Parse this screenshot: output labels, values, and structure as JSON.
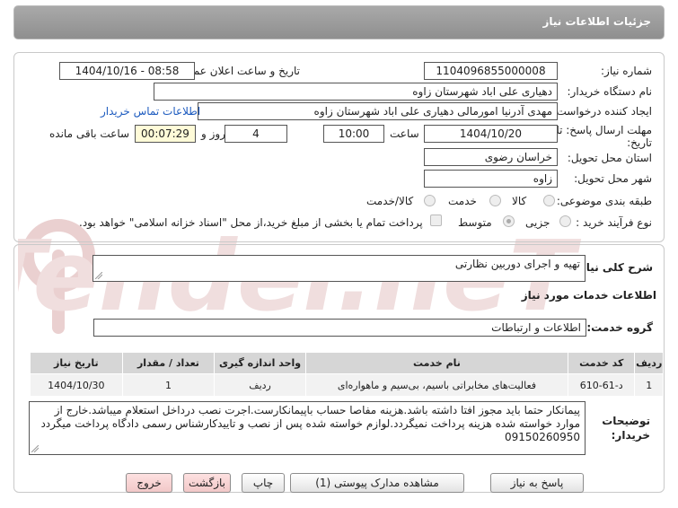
{
  "header": {
    "title": "جزئیات اطلاعات نیاز"
  },
  "watermark": {
    "text": "AriaTender.neT"
  },
  "form": {
    "need_number_label": "شماره نیاز:",
    "need_number": "1104096855000008",
    "announce_label": "تاریخ و ساعت اعلان عمومی:",
    "announce_value": "1404/10/16 - 08:58",
    "buyer_org_label": "نام دستگاه خریدار:",
    "buyer_org": "دهیاری علی اباد شهرستان زاوه",
    "creator_label": "ایجاد کننده درخواست:",
    "creator": "مهدی آدرنیا امورمالی دهیاری علی اباد شهرستان زاوه",
    "contact_link": "اطلاعات تماس خریدار",
    "deadline_label_1": "مهلت ارسال پاسخ: تا",
    "deadline_label_2": "تاریخ:",
    "deadline_date": "1404/10/20",
    "time_label": "ساعت",
    "deadline_time": "10:00",
    "days_value": "4",
    "days_label": "روز و",
    "remaining_time": "00:07:29",
    "remaining_label": "ساعت باقی مانده",
    "province_label": "استان محل تحویل:",
    "province": "خراسان رضوی",
    "city_label": "شهر محل تحویل:",
    "city": "زاوه",
    "category_label": "طبقه بندی موضوعی:",
    "category_options": [
      "کالا",
      "خدمت",
      "کالا/خدمت"
    ],
    "category_selected": "خدمت",
    "process_label": "نوع فرآیند خرید :",
    "process_options": [
      "جزیی",
      "متوسط"
    ],
    "process_selected": "متوسط",
    "payment_note": "پرداخت تمام یا بخشی از مبلغ خرید،از محل \"اسناد خزانه اسلامی\" خواهد بود."
  },
  "need": {
    "summary_label": "شرح کلی نیاز:",
    "summary": "تهیه و اجرای دوربین نظارتی",
    "services_title": "اطلاعات خدمات مورد نیاز",
    "service_group_label": "گروه خدمت:",
    "service_group": "اطلاعات و ارتباطات"
  },
  "table": {
    "headers": [
      "ردیف",
      "کد خدمت",
      "نام خدمت",
      "واحد اندازه گیری",
      "تعداد / مقدار",
      "تاریخ نیاز"
    ],
    "rows": [
      [
        "1",
        "د-61-610",
        "فعالیت‌های مخابراتی باسیم، بی‌سیم و ماهواره‌ای",
        "ردیف",
        "1",
        "1404/10/30"
      ]
    ]
  },
  "buyer_notes": {
    "label_1": "توضیحات",
    "label_2": "خریدار:",
    "text": "پیمانکار حتما باید مجوز افتا داشته باشد.هزینه مفاصا حساب باپیمانکارست.اجرت نصب درداخل استعلام میباشد.خارج از موارد خواسته شده هزینه پرداخت نمیگردد.لوازم خواسته شده پس از نصب و تاییدکارشناس رسمی دادگاه پرداخت میگردد 09150260950"
  },
  "buttons": {
    "reply": "پاسخ به نیاز",
    "attachments": "مشاهده مدارک پیوستی (1)",
    "print": "چاپ",
    "back": "بازگشت",
    "exit": "خروج"
  },
  "colors": {
    "title_bar": "#999999",
    "watermark": "#e8c9c9",
    "link": "#1d5bbf"
  }
}
